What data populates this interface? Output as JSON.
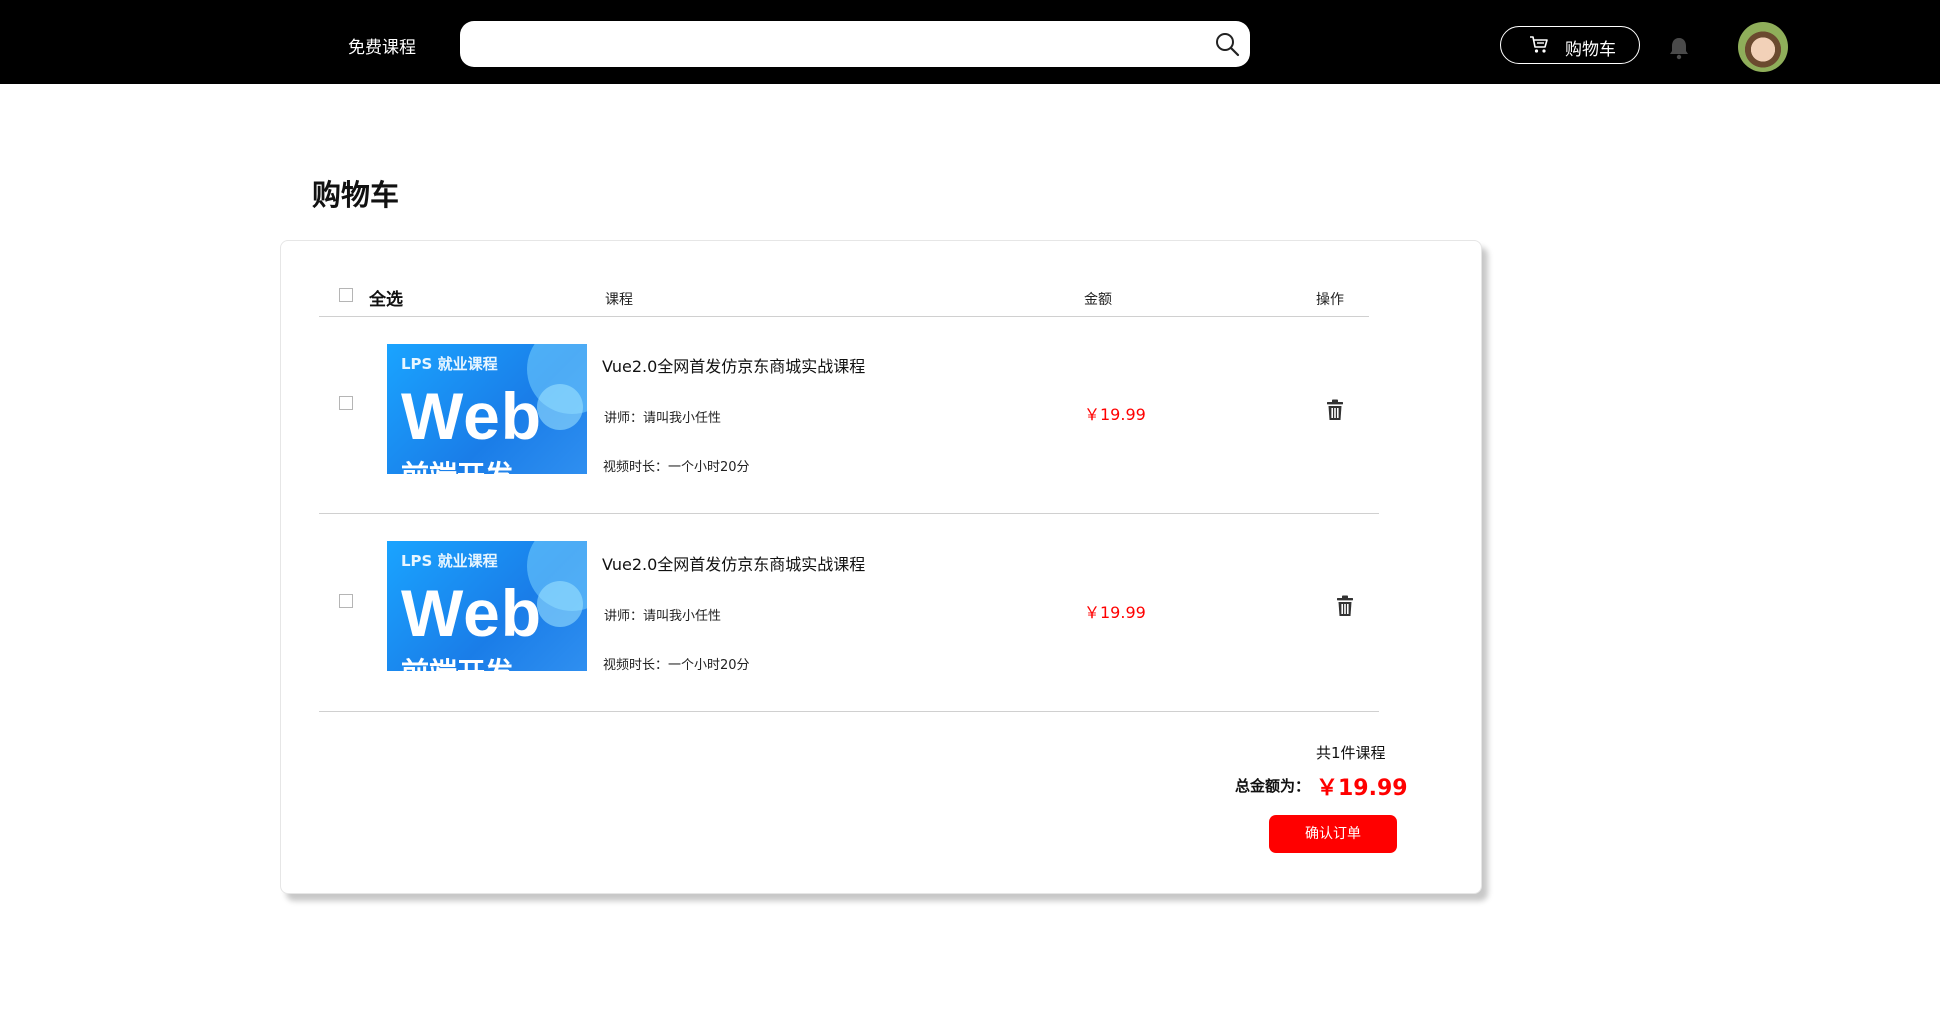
{
  "topbar": {
    "free_courses": "免费课程",
    "search_placeholder": "",
    "cart_label": "购物车",
    "icons": [
      "search-icon",
      "cart-icon",
      "bell-icon"
    ]
  },
  "page": {
    "title": "购物车"
  },
  "table": {
    "select_all": "全选",
    "col_course": "课程",
    "col_amount": "金额",
    "col_action": "操作"
  },
  "items": [
    {
      "thumb_tag": "LPS 就业课程",
      "thumb_big": "Web",
      "thumb_sub": "前端开发",
      "title": "Vue2.0全网首发仿京东商城实战课程",
      "teacher": "讲师：请叫我小任性",
      "duration": "视频时长：一个小时20分",
      "price": "￥19.99"
    },
    {
      "thumb_tag": "LPS 就业课程",
      "thumb_big": "Web",
      "thumb_sub": "前端开发",
      "title": "Vue2.0全网首发仿京东商城实战课程",
      "teacher": "讲师：请叫我小任性",
      "duration": "视频时长：一个小时20分",
      "price": "￥19.99"
    }
  ],
  "summary": {
    "count": "共1件课程",
    "total_label": "总金额为：",
    "total_amount": "￥19.99",
    "confirm": "确认订单"
  },
  "colors": {
    "accent": "#ff0000",
    "topbar": "#000000",
    "thumb": "#1a8cf0"
  }
}
